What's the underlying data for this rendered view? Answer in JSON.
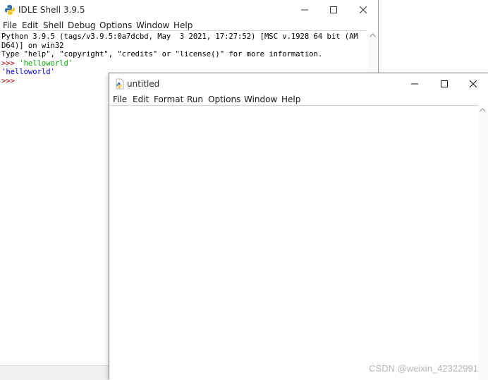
{
  "shell": {
    "title": "IDLE Shell 3.9.5",
    "menu": [
      "File",
      "Edit",
      "Shell",
      "Debug",
      "Options",
      "Window",
      "Help"
    ],
    "lines": [
      {
        "text": "Python 3.9.5 (tags/v3.9.5:0a7dcbd, May  3 2021, 17:27:52) [MSC v.1928 64 bit (AM",
        "color": "#000000"
      },
      {
        "text": "D64)] on win32",
        "color": "#000000"
      },
      {
        "text": "Type \"help\", \"copyright\", \"credits\" or \"license()\" for more information.",
        "color": "#000000"
      }
    ],
    "prompt_symbol": ">>>",
    "entered_code": " 'helloworld'",
    "output": "'helloworld'",
    "prompt_color": "#c00000",
    "code_color": "#00aa00",
    "output_color": "#0000ff"
  },
  "editor": {
    "title": "untitled",
    "menu": [
      "File",
      "Edit",
      "Format",
      "Run",
      "Options",
      "Window",
      "Help"
    ]
  },
  "watermark": "CSDN @weixin_42322991",
  "colors": {
    "window_border": "#7a7a7a",
    "menu_separator": "#cfcfcf",
    "statusbar": "#f0f0f0",
    "python_blue": "#3a6fb0",
    "python_yellow": "#f5c518"
  }
}
